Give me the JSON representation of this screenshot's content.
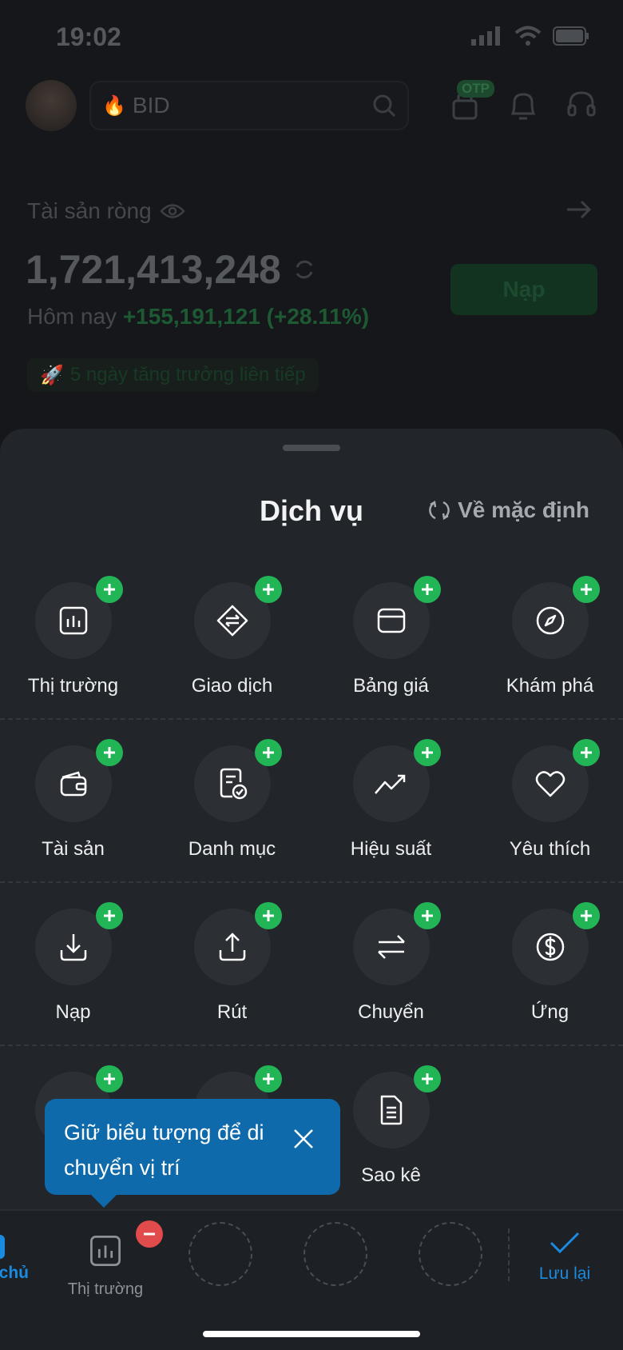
{
  "status_bar": {
    "time": "19:02"
  },
  "header": {
    "search_value": "BID",
    "otp_badge": "OTP"
  },
  "account": {
    "net_asset_label": "Tài sản ròng",
    "net_asset_value": "1,721,413,248",
    "today_label": "Hôm nay",
    "today_change": "+155,191,121 (+28.11%)",
    "deposit_button": "Nạp",
    "streak_text": "5 ngày tăng trưởng liên tiếp"
  },
  "sheet": {
    "title": "Dịch vụ",
    "reset_label": "Về mặc định",
    "rows": [
      [
        {
          "label": "Thị trường",
          "icon": "chart-icon"
        },
        {
          "label": "Giao dịch",
          "icon": "swap-diamond-icon"
        },
        {
          "label": "Bảng giá",
          "icon": "board-icon"
        },
        {
          "label": "Khám phá",
          "icon": "compass-icon"
        }
      ],
      [
        {
          "label": "Tài sản",
          "icon": "wallet-icon"
        },
        {
          "label": "Danh mục",
          "icon": "portfolio-check-icon"
        },
        {
          "label": "Hiệu suất",
          "icon": "trend-up-icon"
        },
        {
          "label": "Yêu thích",
          "icon": "heart-icon"
        }
      ],
      [
        {
          "label": "Nạp",
          "icon": "download-icon"
        },
        {
          "label": "Rút",
          "icon": "upload-icon"
        },
        {
          "label": "Chuyển",
          "icon": "transfer-icon"
        },
        {
          "label": "Ứng",
          "icon": "dollar-icon"
        }
      ],
      [
        {
          "label": "",
          "icon": "hidden-icon"
        },
        {
          "label": "",
          "icon": "hidden-icon"
        },
        {
          "label": "Sao kê",
          "icon": "document-icon"
        }
      ]
    ]
  },
  "tooltip": {
    "text": "Giữ biểu tượng để di chuyển vị trí"
  },
  "bottom_bar": {
    "home_label": "chủ",
    "market_label": "Thị trường",
    "save_label": "Lưu lại"
  },
  "colors": {
    "accent_blue": "#1a8be0",
    "add_green": "#22b556",
    "remove_red": "#e24b4b",
    "tooltip_blue": "#0f6aab"
  }
}
